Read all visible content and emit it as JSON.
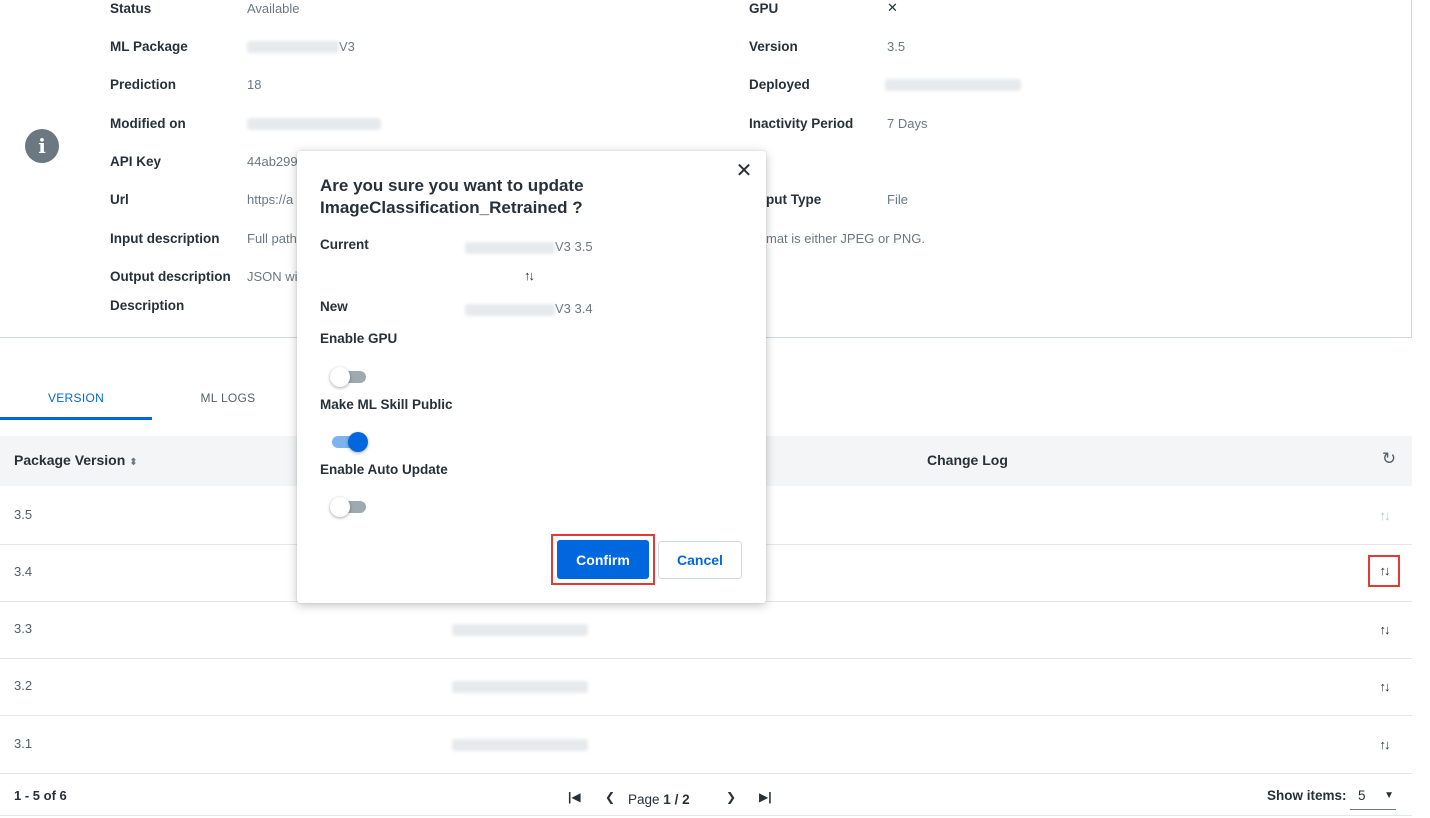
{
  "details": {
    "left": [
      {
        "label": "Status",
        "value": "Available"
      },
      {
        "label": "ML Package",
        "value": "V3"
      },
      {
        "label": "Prediction",
        "value": "18"
      },
      {
        "label": "Modified on",
        "value": ""
      },
      {
        "label": "API Key",
        "value": "44ab299"
      },
      {
        "label": "Url",
        "value": "https://a"
      },
      {
        "label": "Input description",
        "value": "Full path"
      },
      {
        "label": "Output description",
        "value": "JSON wit"
      },
      {
        "label": "Description",
        "value": ""
      }
    ],
    "right": [
      {
        "label": "GPU",
        "value": "✕"
      },
      {
        "label": "Version",
        "value": "3.5"
      },
      {
        "label": "Deployed",
        "value": ""
      },
      {
        "label": "Inactivity Period",
        "value": "7 Days"
      },
      {
        "label": "put Type",
        "value": "File"
      },
      {
        "label": "",
        "value": "mat is either JPEG or PNG."
      }
    ],
    "info_icon": "info-icon"
  },
  "tabs": [
    {
      "label": "VERSION",
      "active": true
    },
    {
      "label": "ML LOGS",
      "active": false
    }
  ],
  "table": {
    "columns": {
      "package_version": "Package Version",
      "change_log": "Change Log"
    },
    "sort_icon": "↕",
    "rows": [
      {
        "version": "3.5"
      },
      {
        "version": "3.4"
      },
      {
        "version": "3.3"
      },
      {
        "version": "3.2"
      },
      {
        "version": "3.1"
      }
    ],
    "action_icon": "↑↓"
  },
  "pagination": {
    "range": "1 - 5 of 6",
    "page_label": "Page",
    "current_page": "1",
    "separator": "/",
    "total_pages": "2",
    "show_items_label": "Show items:",
    "show_items_value": "5"
  },
  "modal": {
    "title_line1": "Are you sure you want to update",
    "title_line2": "ImageClassification_Retrained ?",
    "current_label": "Current",
    "current_value": "V3 3.5",
    "new_label": "New",
    "new_value": "V3 3.4",
    "swap_icon": "↑↓",
    "toggles": [
      {
        "label": "Enable GPU",
        "on": false
      },
      {
        "label": "Make ML Skill Public",
        "on": true
      },
      {
        "label": "Enable Auto Update",
        "on": false
      }
    ],
    "confirm_label": "Confirm",
    "cancel_label": "Cancel",
    "close_icon": "✕"
  },
  "colors": {
    "accent": "#0067df",
    "highlight_border": "#e53935",
    "header_bg": "#f4f5f7"
  }
}
